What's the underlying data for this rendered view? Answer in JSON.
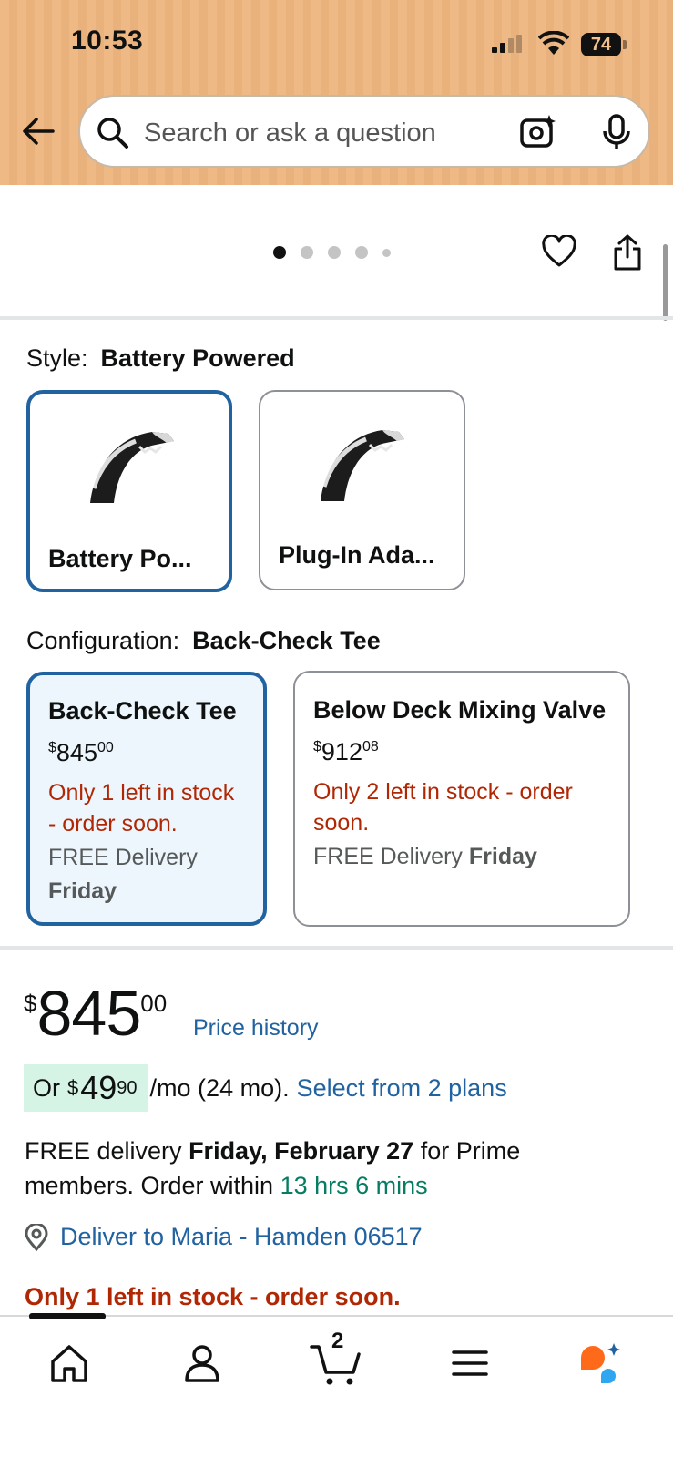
{
  "status_bar": {
    "time": "10:53",
    "battery": "74"
  },
  "search": {
    "placeholder": "Search or ask a question"
  },
  "carousel": {
    "dot_count": 5,
    "active_index": 0
  },
  "style": {
    "label": "Style:",
    "selected_value": "Battery Powered",
    "options": [
      {
        "label": "Battery Po...",
        "selected": true
      },
      {
        "label": "Plug-In Ada...",
        "selected": false
      }
    ]
  },
  "configuration": {
    "label": "Configuration:",
    "selected_value": "Back-Check Tee",
    "options": [
      {
        "title": "Back-Check Tee",
        "price_whole": "845",
        "price_frac": "00",
        "stock_line1": "Only 1 left in stock",
        "stock_line2": "- order soon.",
        "delivery_prefix": "FREE Delivery",
        "delivery_day": "Friday",
        "selected": true
      },
      {
        "title": "Below Deck Mixing Valve",
        "price_whole": "912",
        "price_frac": "08",
        "stock_line1": "Only 2 left in stock - order",
        "stock_line2": "soon.",
        "delivery_prefix": "FREE Delivery",
        "delivery_day": "Friday",
        "selected": false
      }
    ]
  },
  "price": {
    "currency": "$",
    "whole": "845",
    "fraction": "00",
    "history_link": "Price history"
  },
  "financing": {
    "prefix": "Or",
    "currency": "$",
    "monthly_whole": "49",
    "monthly_frac": "90",
    "term": "/mo (24 mo).",
    "link": "Select from 2 plans"
  },
  "delivery": {
    "prefix": "FREE delivery",
    "date": "Friday, February 27",
    "suffix": "for Prime members. Order within",
    "countdown": "13 hrs 6 mins"
  },
  "deliver_to": {
    "text": "Deliver to Maria - Hamden 06517"
  },
  "stock_notice": "Only 1 left in stock - order soon.",
  "bottom_nav": {
    "items": [
      "home-icon",
      "account-icon",
      "cart-icon",
      "menu-icon",
      "rufus-icon"
    ],
    "cart_count": "2"
  },
  "colors": {
    "link": "#2162a1",
    "stock_red": "#b12704",
    "green": "#067d62",
    "selected_border": "#2162a1",
    "finance_highlight": "#d5f4e5"
  }
}
